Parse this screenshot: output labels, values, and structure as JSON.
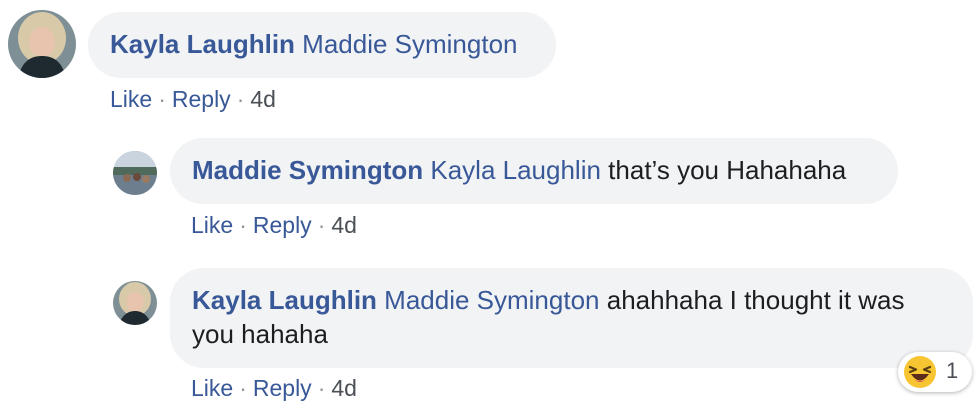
{
  "comments": [
    {
      "author": "Kayla Laughlin",
      "tag": "Maddie Symington",
      "text": "",
      "actions": {
        "like": "Like",
        "reply": "Reply",
        "sep": "·",
        "time": "4d"
      }
    },
    {
      "author": "Maddie Symington",
      "tag": "Kayla Laughlin",
      "text": "that’s you Hahahaha",
      "actions": {
        "like": "Like",
        "reply": "Reply",
        "sep": "·",
        "time": "4d"
      }
    },
    {
      "author": "Kayla Laughlin",
      "tag": "Maddie Symington",
      "text": "ahahhaha I thought it was you hahaha",
      "actions": {
        "like": "Like",
        "reply": "Reply",
        "sep": "·",
        "time": "4d"
      },
      "reaction": {
        "icon": "laughing-emoji-icon",
        "count": "1"
      }
    }
  ],
  "colors": {
    "link": "#385898",
    "bubble": "#f2f3f5",
    "text": "#1c1e21",
    "meta": "#4b4f56"
  }
}
